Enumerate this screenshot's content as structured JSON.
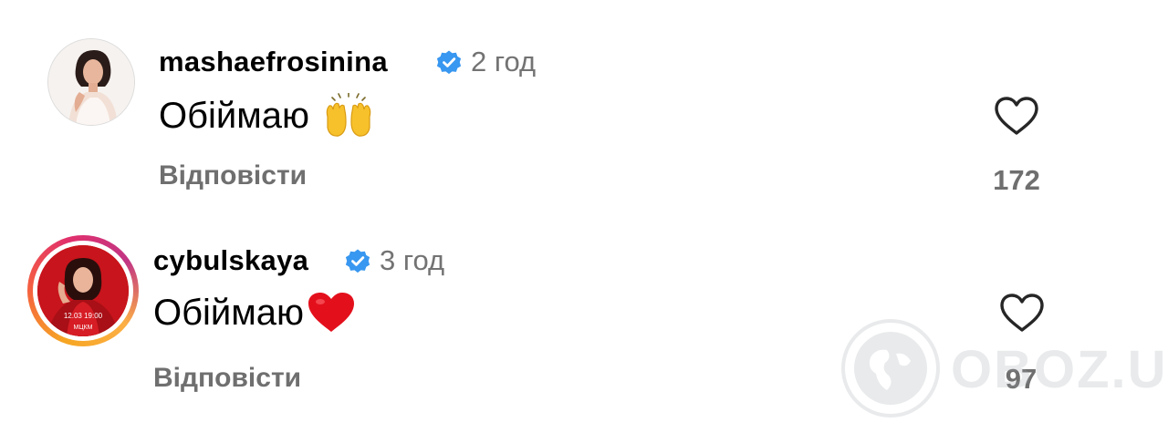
{
  "comments": [
    {
      "username": "mashaefrosinina",
      "verified": true,
      "time": "2 год",
      "text": "Обіймаю",
      "emoji": "raising-hands",
      "reply_label": "Відповісти",
      "likes": "172",
      "avatar_story_ring": false
    },
    {
      "username": "cybulskaya",
      "verified": true,
      "time": "3 год",
      "text": "Обіймаю",
      "emoji": "red-heart",
      "reply_label": "Відповісти",
      "likes": "97",
      "avatar_story_ring": true,
      "avatar_text": {
        "date": "12.03 19:00",
        "venue": "МЦКМ"
      }
    }
  ],
  "watermark": {
    "text": "OBOZ.UA"
  },
  "colors": {
    "verified": "#3897f0",
    "secondary_text": "#737373",
    "heart_outline": "#262626",
    "emoji_heart": "#e3101c",
    "emoji_hands": "#f7c12b"
  }
}
